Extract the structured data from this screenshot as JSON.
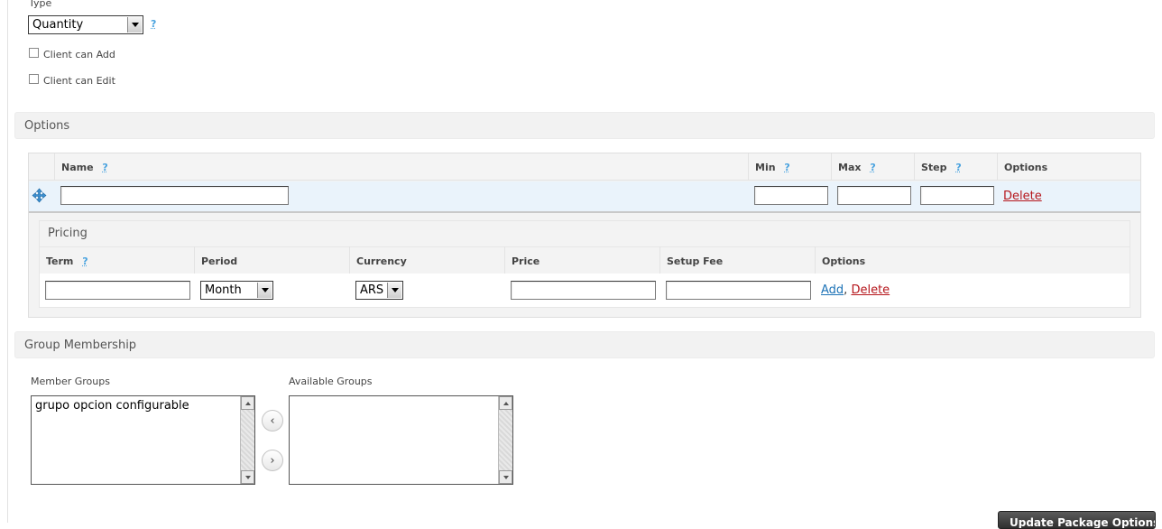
{
  "type_field": {
    "label": "Type",
    "value": "Quantity",
    "help": "?",
    "client_can_add": "Client can Add",
    "client_can_edit": "Client can Edit"
  },
  "options_section": {
    "title": "Options",
    "columns": {
      "name": "Name",
      "min": "Min",
      "max": "Max",
      "step": "Step",
      "options": "Options"
    },
    "help": "?",
    "delete": "Delete",
    "drag_icon": "move-icon"
  },
  "pricing": {
    "title": "Pricing",
    "columns": {
      "term": "Term",
      "period": "Period",
      "currency": "Currency",
      "price": "Price",
      "setup_fee": "Setup Fee",
      "options": "Options"
    },
    "help": "?",
    "period_value": "Month",
    "currency_value": "ARS",
    "add": "Add",
    "separator": ",",
    "delete": "Delete"
  },
  "group_membership": {
    "title": "Group Membership",
    "member_groups_label": "Member Groups",
    "member_groups": [
      "grupo opcion configurable"
    ],
    "available_groups_label": "Available Groups",
    "move_left": "‹",
    "move_right": "›"
  },
  "footer": {
    "update_button": "Update Package Options"
  },
  "colors": {
    "help": "#4aa3df",
    "link_blue": "#1d73b7",
    "link_red": "#b5151b",
    "row_highlight": "#eaf3fb"
  }
}
